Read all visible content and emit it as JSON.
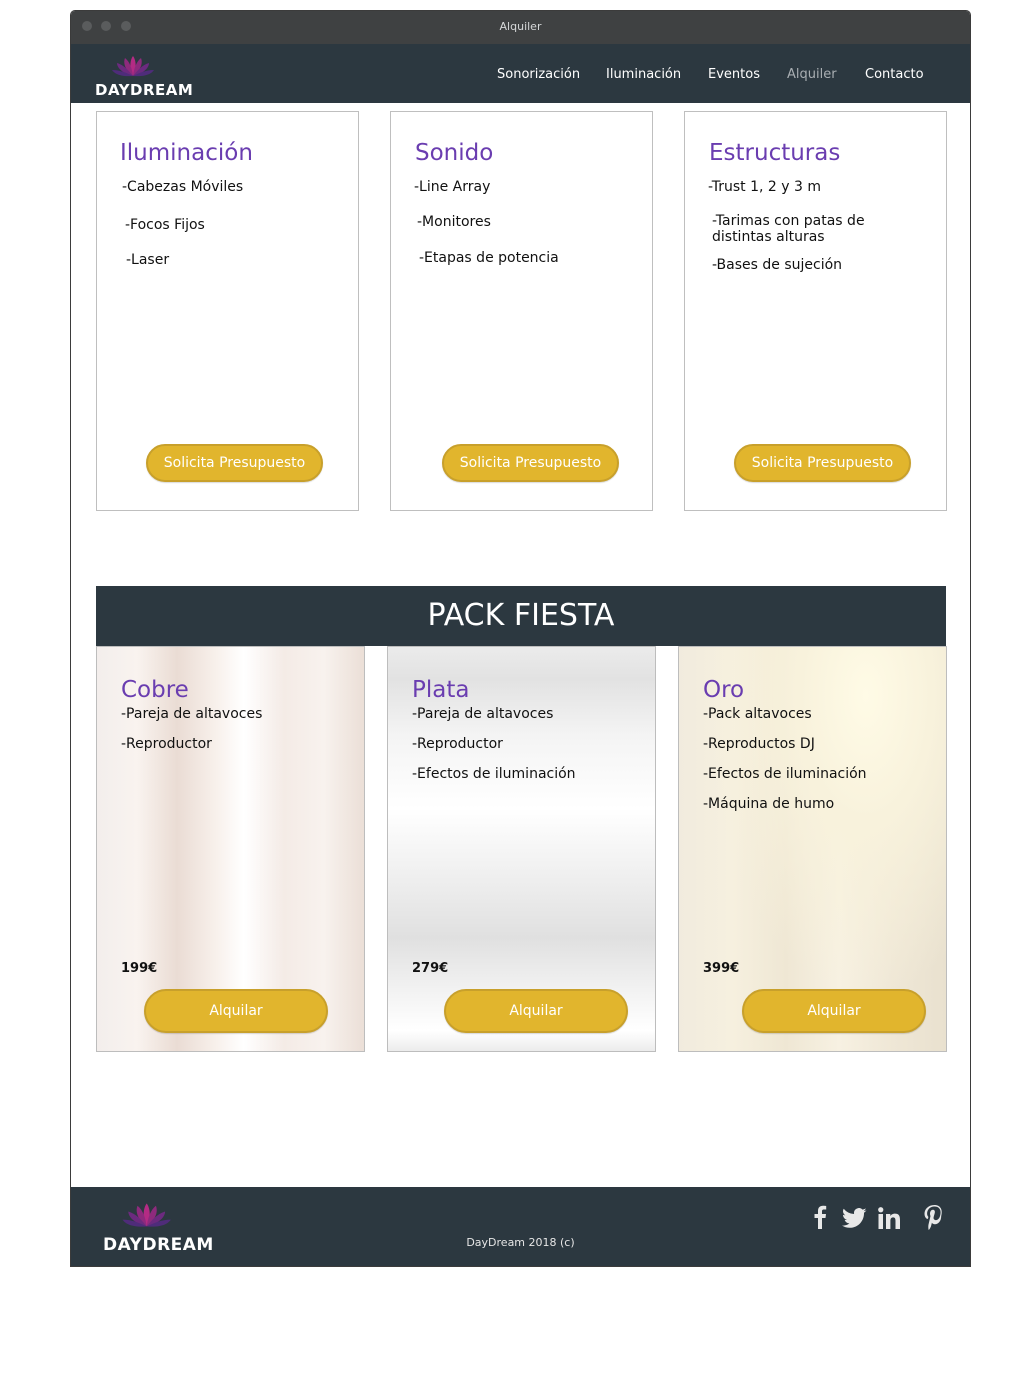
{
  "window": {
    "title": "Alquiler"
  },
  "brand": {
    "logo_text": "DAYDREAM"
  },
  "nav": {
    "items": [
      {
        "label": "Sonorización"
      },
      {
        "label": "Iluminación"
      },
      {
        "label": "Eventos"
      },
      {
        "label": "Alquiler",
        "active": true
      },
      {
        "label": "Contacto"
      }
    ]
  },
  "services": [
    {
      "title": "Iluminación",
      "items": [
        "-Cabezas Móviles",
        "-Focos Fijos",
        "-Laser"
      ],
      "button": "Solicita Presupuesto"
    },
    {
      "title": "Sonido",
      "items": [
        "-Line Array",
        "-Monitores",
        "-Etapas de potencia"
      ],
      "button": "Solicita Presupuesto"
    },
    {
      "title": "Estructuras",
      "items": [
        "-Trust 1, 2 y 3 m",
        "-Tarimas con patas de",
        "distintas alturas",
        "-Bases de sujeción"
      ],
      "button": "Solicita Presupuesto"
    }
  ],
  "pack": {
    "heading": "PACK FIESTA",
    "tiers": [
      {
        "title": "Cobre",
        "items": [
          "-Pareja de altavoces",
          "-Reproductor"
        ],
        "price": "199€",
        "button": "Alquilar"
      },
      {
        "title": "Plata",
        "items": [
          "-Pareja de altavoces",
          "-Reproductor",
          "-Efectos de iluminación"
        ],
        "price": "279€",
        "button": "Alquilar"
      },
      {
        "title": "Oro",
        "items": [
          "-Pack altavoces",
          "-Reproductos DJ",
          "-Efectos de iluminación",
          "-Máquina de humo"
        ],
        "price": "399€",
        "button": "Alquilar"
      }
    ]
  },
  "footer": {
    "copyright": "DayDream 2018 (c)",
    "social": [
      "facebook-icon",
      "twitter-icon",
      "linkedin-icon",
      "pinterest-icon"
    ]
  },
  "colors": {
    "navbar": "#2c3840",
    "accent_title": "#6a3db0",
    "button": "#e1b52d",
    "logo_magenta": "#a3257a"
  }
}
